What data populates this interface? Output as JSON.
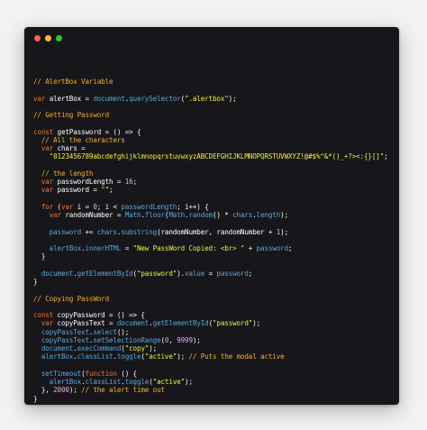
{
  "window": {
    "controls": [
      "close",
      "minimize",
      "maximize"
    ]
  },
  "code_lines": [
    [
      {
        "t": "c",
        "v": "// AlertBox Variable"
      }
    ],
    [],
    [
      {
        "t": "k",
        "v": "var "
      },
      {
        "t": "v",
        "v": "alertBox "
      },
      {
        "t": "p",
        "v": "= "
      },
      {
        "t": "f",
        "v": "document"
      },
      {
        "t": "p",
        "v": "."
      },
      {
        "t": "f",
        "v": "querySelector"
      },
      {
        "t": "p",
        "v": "("
      },
      {
        "t": "s",
        "v": "\".alertbox\""
      },
      {
        "t": "p",
        "v": ");"
      }
    ],
    [],
    [
      {
        "t": "c",
        "v": "// Getting Password"
      }
    ],
    [],
    [
      {
        "t": "k",
        "v": "const "
      },
      {
        "t": "v",
        "v": "getPassword "
      },
      {
        "t": "p",
        "v": "= () => {"
      }
    ],
    [
      {
        "t": "c",
        "v": "  // All the characters"
      }
    ],
    [
      {
        "t": "k",
        "v": "  var "
      },
      {
        "t": "v",
        "v": "chars "
      },
      {
        "t": "p",
        "v": "="
      }
    ],
    [
      {
        "t": "s",
        "v": "    \"0123456789abcdefghijklmnopqrstuvwxyzABCDEFGHIJKLMNOPQRSTUVWXYZ!@#$%^&*()_+?><:{}[]\""
      },
      {
        "t": "p",
        "v": ";"
      }
    ],
    [],
    [
      {
        "t": "c",
        "v": "  // the length"
      }
    ],
    [
      {
        "t": "k",
        "v": "  var "
      },
      {
        "t": "v",
        "v": "passwordLength "
      },
      {
        "t": "p",
        "v": "= "
      },
      {
        "t": "n",
        "v": "16"
      },
      {
        "t": "p",
        "v": ";"
      }
    ],
    [
      {
        "t": "k",
        "v": "  var "
      },
      {
        "t": "v",
        "v": "password "
      },
      {
        "t": "p",
        "v": "= "
      },
      {
        "t": "s",
        "v": "\"\""
      },
      {
        "t": "p",
        "v": ";"
      }
    ],
    [],
    [
      {
        "t": "k",
        "v": "  for "
      },
      {
        "t": "p",
        "v": "("
      },
      {
        "t": "k",
        "v": "var "
      },
      {
        "t": "v",
        "v": "i "
      },
      {
        "t": "p",
        "v": "= "
      },
      {
        "t": "n",
        "v": "0"
      },
      {
        "t": "p",
        "v": "; "
      },
      {
        "t": "v",
        "v": "i "
      },
      {
        "t": "p",
        "v": "< "
      },
      {
        "t": "f",
        "v": "passwordLength"
      },
      {
        "t": "p",
        "v": "; "
      },
      {
        "t": "v",
        "v": "i"
      },
      {
        "t": "p",
        "v": "++) {"
      }
    ],
    [
      {
        "t": "k",
        "v": "    var "
      },
      {
        "t": "v",
        "v": "randomNumber "
      },
      {
        "t": "p",
        "v": "= "
      },
      {
        "t": "f",
        "v": "Math"
      },
      {
        "t": "p",
        "v": "."
      },
      {
        "t": "f",
        "v": "floor"
      },
      {
        "t": "p",
        "v": "("
      },
      {
        "t": "f",
        "v": "Math"
      },
      {
        "t": "p",
        "v": "."
      },
      {
        "t": "f",
        "v": "random"
      },
      {
        "t": "p",
        "v": "() * "
      },
      {
        "t": "f",
        "v": "chars"
      },
      {
        "t": "p",
        "v": "."
      },
      {
        "t": "f",
        "v": "length"
      },
      {
        "t": "p",
        "v": ");"
      }
    ],
    [],
    [
      {
        "t": "f",
        "v": "    password "
      },
      {
        "t": "p",
        "v": "+= "
      },
      {
        "t": "f",
        "v": "chars"
      },
      {
        "t": "p",
        "v": "."
      },
      {
        "t": "f",
        "v": "substring"
      },
      {
        "t": "p",
        "v": "(randomNumber, randomNumber + "
      },
      {
        "t": "n",
        "v": "1"
      },
      {
        "t": "p",
        "v": ");"
      }
    ],
    [],
    [
      {
        "t": "f",
        "v": "    alertBox"
      },
      {
        "t": "p",
        "v": "."
      },
      {
        "t": "f",
        "v": "innerHTML "
      },
      {
        "t": "p",
        "v": "= "
      },
      {
        "t": "s",
        "v": "\"New PassWord Copied: <br> \""
      },
      {
        "t": "p",
        "v": " + "
      },
      {
        "t": "f",
        "v": "password"
      },
      {
        "t": "p",
        "v": ";"
      }
    ],
    [
      {
        "t": "p",
        "v": "  }"
      }
    ],
    [],
    [
      {
        "t": "f",
        "v": "  document"
      },
      {
        "t": "p",
        "v": "."
      },
      {
        "t": "f",
        "v": "getElementById"
      },
      {
        "t": "p",
        "v": "("
      },
      {
        "t": "s",
        "v": "\"password\""
      },
      {
        "t": "p",
        "v": ")."
      },
      {
        "t": "f",
        "v": "value "
      },
      {
        "t": "p",
        "v": "= "
      },
      {
        "t": "f",
        "v": "password"
      },
      {
        "t": "p",
        "v": ";"
      }
    ],
    [
      {
        "t": "p",
        "v": "}"
      }
    ],
    [],
    [
      {
        "t": "c",
        "v": "// Copying PassWord"
      }
    ],
    [],
    [
      {
        "t": "k",
        "v": "const "
      },
      {
        "t": "v",
        "v": "copyPassword "
      },
      {
        "t": "p",
        "v": "= () => {"
      }
    ],
    [
      {
        "t": "k",
        "v": "  var "
      },
      {
        "t": "v",
        "v": "copyPassText "
      },
      {
        "t": "p",
        "v": "= "
      },
      {
        "t": "f",
        "v": "document"
      },
      {
        "t": "p",
        "v": "."
      },
      {
        "t": "f",
        "v": "getElementById"
      },
      {
        "t": "p",
        "v": "("
      },
      {
        "t": "s",
        "v": "\"password\""
      },
      {
        "t": "p",
        "v": ");"
      }
    ],
    [
      {
        "t": "f",
        "v": "  copyPassText"
      },
      {
        "t": "p",
        "v": "."
      },
      {
        "t": "f",
        "v": "select"
      },
      {
        "t": "p",
        "v": "();"
      }
    ],
    [
      {
        "t": "f",
        "v": "  copyPassText"
      },
      {
        "t": "p",
        "v": "."
      },
      {
        "t": "f",
        "v": "setSelectionRange"
      },
      {
        "t": "p",
        "v": "("
      },
      {
        "t": "n",
        "v": "0"
      },
      {
        "t": "p",
        "v": ", "
      },
      {
        "t": "n",
        "v": "9999"
      },
      {
        "t": "p",
        "v": ");"
      }
    ],
    [
      {
        "t": "f",
        "v": "  document"
      },
      {
        "t": "p",
        "v": "."
      },
      {
        "t": "f",
        "v": "execCommand"
      },
      {
        "t": "p",
        "v": "("
      },
      {
        "t": "s",
        "v": "\"copy\""
      },
      {
        "t": "p",
        "v": ");"
      }
    ],
    [
      {
        "t": "f",
        "v": "  alertBox"
      },
      {
        "t": "p",
        "v": "."
      },
      {
        "t": "f",
        "v": "classList"
      },
      {
        "t": "p",
        "v": "."
      },
      {
        "t": "f",
        "v": "toggle"
      },
      {
        "t": "p",
        "v": "("
      },
      {
        "t": "s",
        "v": "\"active\""
      },
      {
        "t": "p",
        "v": "); "
      },
      {
        "t": "c",
        "v": "// Puts the modal active"
      }
    ],
    [],
    [
      {
        "t": "f",
        "v": "  setTimeout"
      },
      {
        "t": "p",
        "v": "("
      },
      {
        "t": "k",
        "v": "function "
      },
      {
        "t": "p",
        "v": "() {"
      }
    ],
    [
      {
        "t": "f",
        "v": "    alertBox"
      },
      {
        "t": "p",
        "v": "."
      },
      {
        "t": "f",
        "v": "classList"
      },
      {
        "t": "p",
        "v": "."
      },
      {
        "t": "f",
        "v": "toggle"
      },
      {
        "t": "p",
        "v": "("
      },
      {
        "t": "s",
        "v": "\"active\""
      },
      {
        "t": "p",
        "v": ");"
      }
    ],
    [
      {
        "t": "p",
        "v": "  }, "
      },
      {
        "t": "n",
        "v": "2000"
      },
      {
        "t": "p",
        "v": "); "
      },
      {
        "t": "c",
        "v": "// the alert time out"
      }
    ],
    [
      {
        "t": "p",
        "v": "}"
      }
    ]
  ],
  "colors": {
    "background": "#f2f2f2",
    "editor": "#17161a",
    "comment": "#f0b03a",
    "keyword": "#e8783c",
    "function": "#5ba6d9",
    "string": "#eef23c",
    "number": "#e8a6f0"
  }
}
